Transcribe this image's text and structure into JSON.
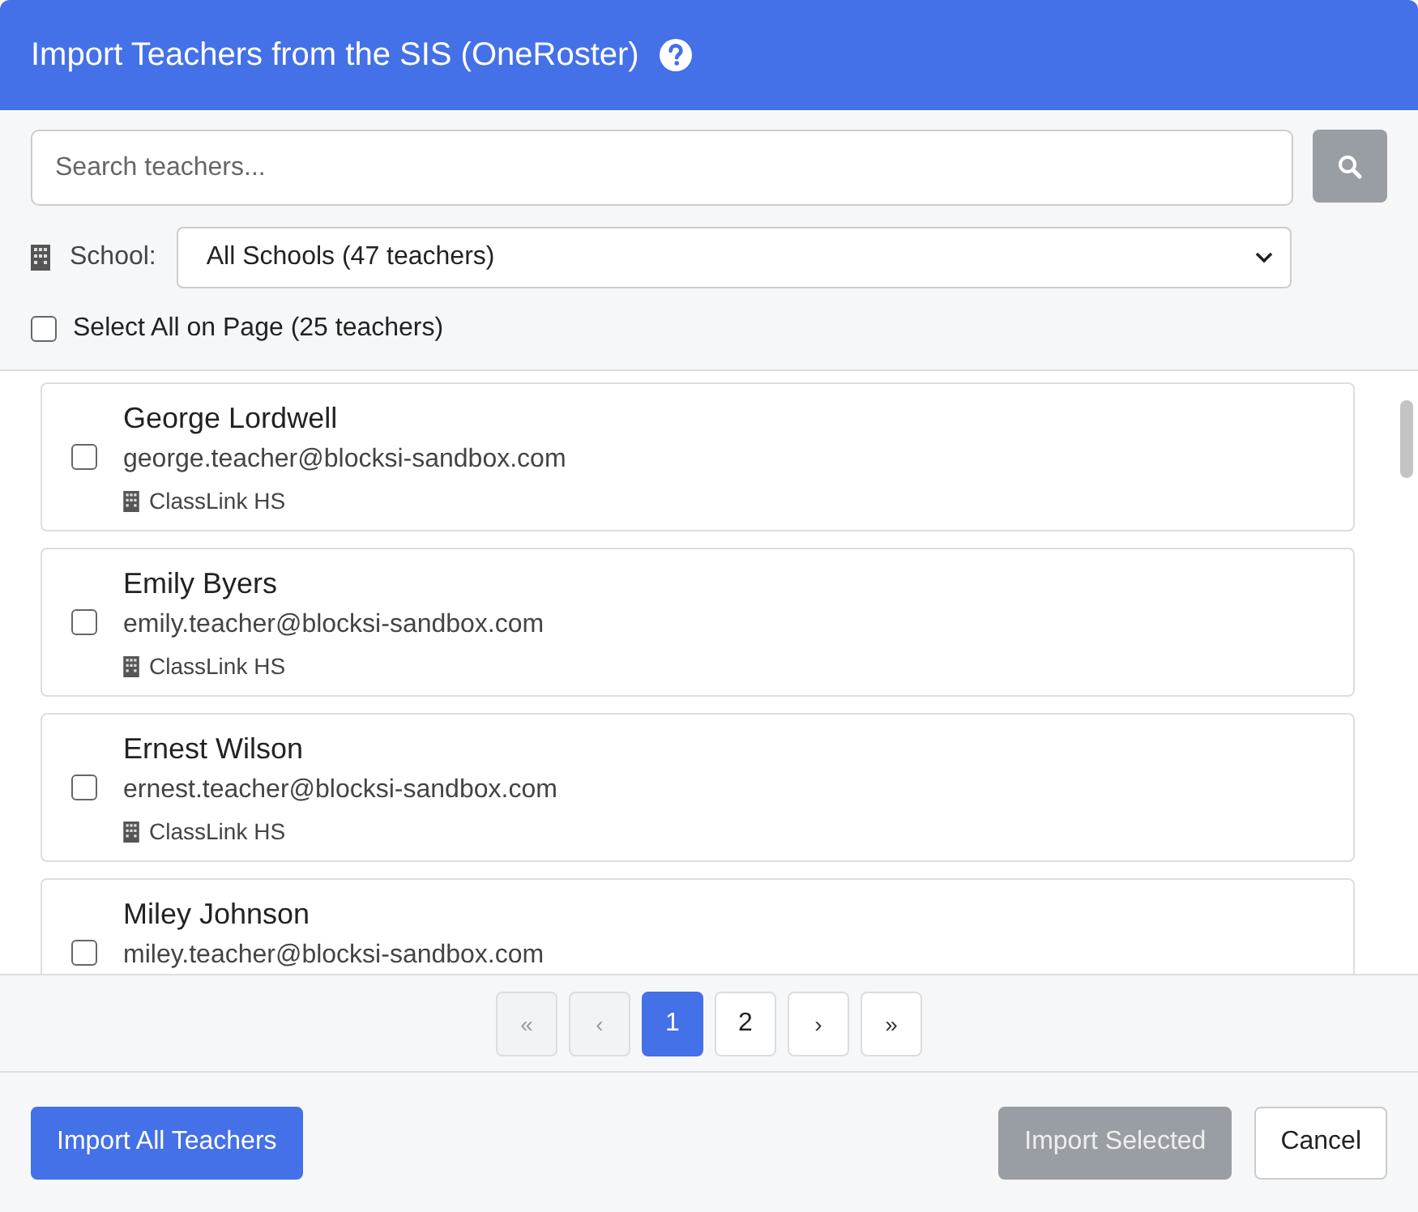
{
  "header": {
    "title": "Import Teachers from the SIS (OneRoster)"
  },
  "search": {
    "placeholder": "Search teachers..."
  },
  "school_filter": {
    "label": "School:",
    "value": "All Schools (47 teachers)"
  },
  "select_all": {
    "label": "Select All on Page (25 teachers)",
    "checked": false
  },
  "teachers": [
    {
      "name": "George Lordwell",
      "email": "george.teacher@blocksi-sandbox.com",
      "school": "ClassLink HS",
      "checked": false
    },
    {
      "name": "Emily Byers",
      "email": "emily.teacher@blocksi-sandbox.com",
      "school": "ClassLink HS",
      "checked": false
    },
    {
      "name": "Ernest Wilson",
      "email": "ernest.teacher@blocksi-sandbox.com",
      "school": "ClassLink HS",
      "checked": false
    },
    {
      "name": "Miley Johnson",
      "email": "miley.teacher@blocksi-sandbox.com",
      "checked": false
    }
  ],
  "pagination": [
    {
      "label": "«",
      "kind": "first",
      "selected": false,
      "disabled": true
    },
    {
      "label": "‹",
      "kind": "prev",
      "selected": false,
      "disabled": true
    },
    {
      "label": "1",
      "kind": "page",
      "selected": true,
      "disabled": false
    },
    {
      "label": "2",
      "kind": "page",
      "selected": false,
      "disabled": false
    },
    {
      "label": "›",
      "kind": "next",
      "selected": false,
      "disabled": false
    },
    {
      "label": "»",
      "kind": "last",
      "selected": false,
      "disabled": false
    }
  ],
  "footer": {
    "import_all": "Import All Teachers",
    "import_selected": {
      "label": "Import Selected",
      "disabled": true
    },
    "cancel": "Cancel"
  }
}
